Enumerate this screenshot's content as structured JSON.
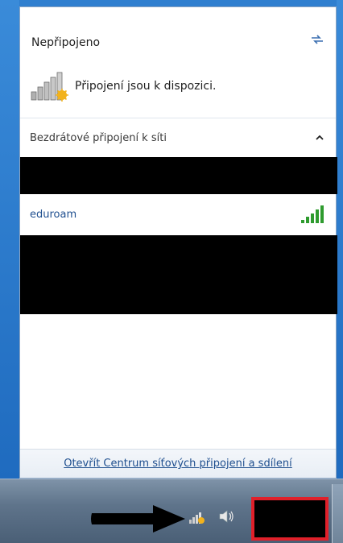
{
  "flyout": {
    "status_title": "Nepřipojeno",
    "status_text": "Připojení jsou k dispozici.",
    "section_title": "Bezdrátové připojení k síti",
    "networks": [
      {
        "name": "eduroam",
        "icon": "signal-bars-icon"
      }
    ],
    "footer_link": "Otevřít Centrum síťových připojení a sdílení"
  },
  "icons": {
    "refresh": "refresh-icon",
    "status": "network-unavailable-icon",
    "collapse": "chevron-up-icon",
    "tray_network": "network-tray-icon",
    "tray_volume": "volume-icon"
  },
  "colors": {
    "link": "#1f4f8f",
    "signal_green": "#2e9b2e",
    "warning_star": "#f2b21c",
    "redaction": "#000000",
    "highlight_box": "#e0202a"
  }
}
